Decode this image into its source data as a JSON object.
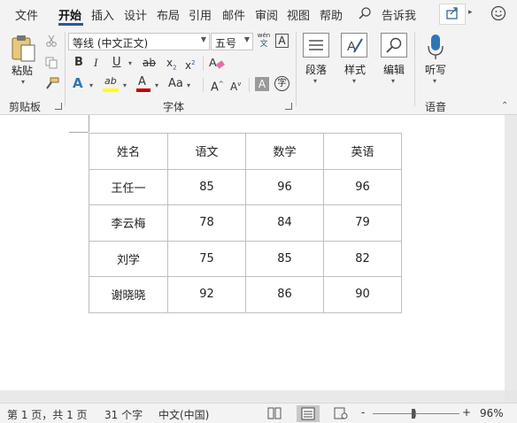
{
  "tabs": [
    {
      "label": "文件",
      "active": false
    },
    {
      "label": "开始",
      "active": true
    },
    {
      "label": "插入",
      "active": false
    },
    {
      "label": "设计",
      "active": false
    },
    {
      "label": "布局",
      "active": false
    },
    {
      "label": "引用",
      "active": false
    },
    {
      "label": "邮件",
      "active": false
    },
    {
      "label": "审阅",
      "active": false
    },
    {
      "label": "视图",
      "active": false
    },
    {
      "label": "帮助",
      "active": false
    }
  ],
  "tell_me": "告诉我",
  "ribbon": {
    "clipboard": {
      "paste_label": "粘贴",
      "group_label": "剪贴板"
    },
    "font": {
      "font_name": "等线 (中文正文)",
      "font_size": "五号",
      "phonetic_top": "wén",
      "phonetic_bottom": "文",
      "border_char": "A",
      "bold": "B",
      "italic": "I",
      "underline": "U",
      "strike": "ab",
      "subscript": "x",
      "subscript_mark": "2",
      "superscript": "x",
      "superscript_mark": "2",
      "text_effect": "A",
      "highlight": "ab",
      "font_color": "A",
      "change_case": "Aa",
      "grow": "A",
      "shrink": "A",
      "shading_char": "A",
      "enclose_char": "字",
      "group_label": "字体"
    },
    "paragraph": {
      "label": "段落"
    },
    "styles": {
      "label": "样式"
    },
    "editing": {
      "label": "编辑"
    },
    "dictate": {
      "label": "听写",
      "group_label": "语音"
    }
  },
  "table": {
    "rows": [
      [
        "姓名",
        "语文",
        "数学",
        "英语"
      ],
      [
        "王任一",
        "85",
        "96",
        "96"
      ],
      [
        "李云梅",
        "78",
        "84",
        "79"
      ],
      [
        "刘学",
        "75",
        "85",
        "82"
      ],
      [
        "谢晓晓",
        "92",
        "86",
        "90"
      ]
    ]
  },
  "status": {
    "page": "第 1 页，共 1 页",
    "words": "31 个字",
    "language": "中文(中国)",
    "zoom_minus": "-",
    "zoom_plus": "+",
    "zoom": "96%",
    "zoom_level": 0.96
  },
  "colors": {
    "accent": "#2b579a",
    "highlight": "#ffff00",
    "font_color": "#c00000",
    "effect_blue": "#2e75b6"
  }
}
